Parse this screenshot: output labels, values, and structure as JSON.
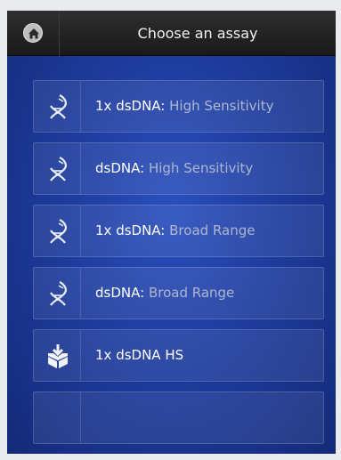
{
  "header": {
    "title": "Choose an assay",
    "home_icon": "home-icon"
  },
  "assays": [
    {
      "prefix": "1x dsDNA:",
      "suffix": "High Sensitivity",
      "icon": "dna-icon"
    },
    {
      "prefix": "dsDNA:",
      "suffix": "High Sensitivity",
      "icon": "dna-icon"
    },
    {
      "prefix": "1x dsDNA:",
      "suffix": "Broad Range",
      "icon": "dna-icon"
    },
    {
      "prefix": "dsDNA:",
      "suffix": "Broad Range",
      "icon": "dna-icon"
    },
    {
      "prefix": "1x dsDNA HS",
      "suffix": "",
      "icon": "download-box-icon"
    },
    {
      "prefix": "",
      "suffix": "",
      "icon": ""
    }
  ],
  "colors": {
    "background": "#1e3c9e",
    "titlebar": "#1f1f1f",
    "label_primary": "#ffffff",
    "label_secondary": "#aeb7cf"
  }
}
